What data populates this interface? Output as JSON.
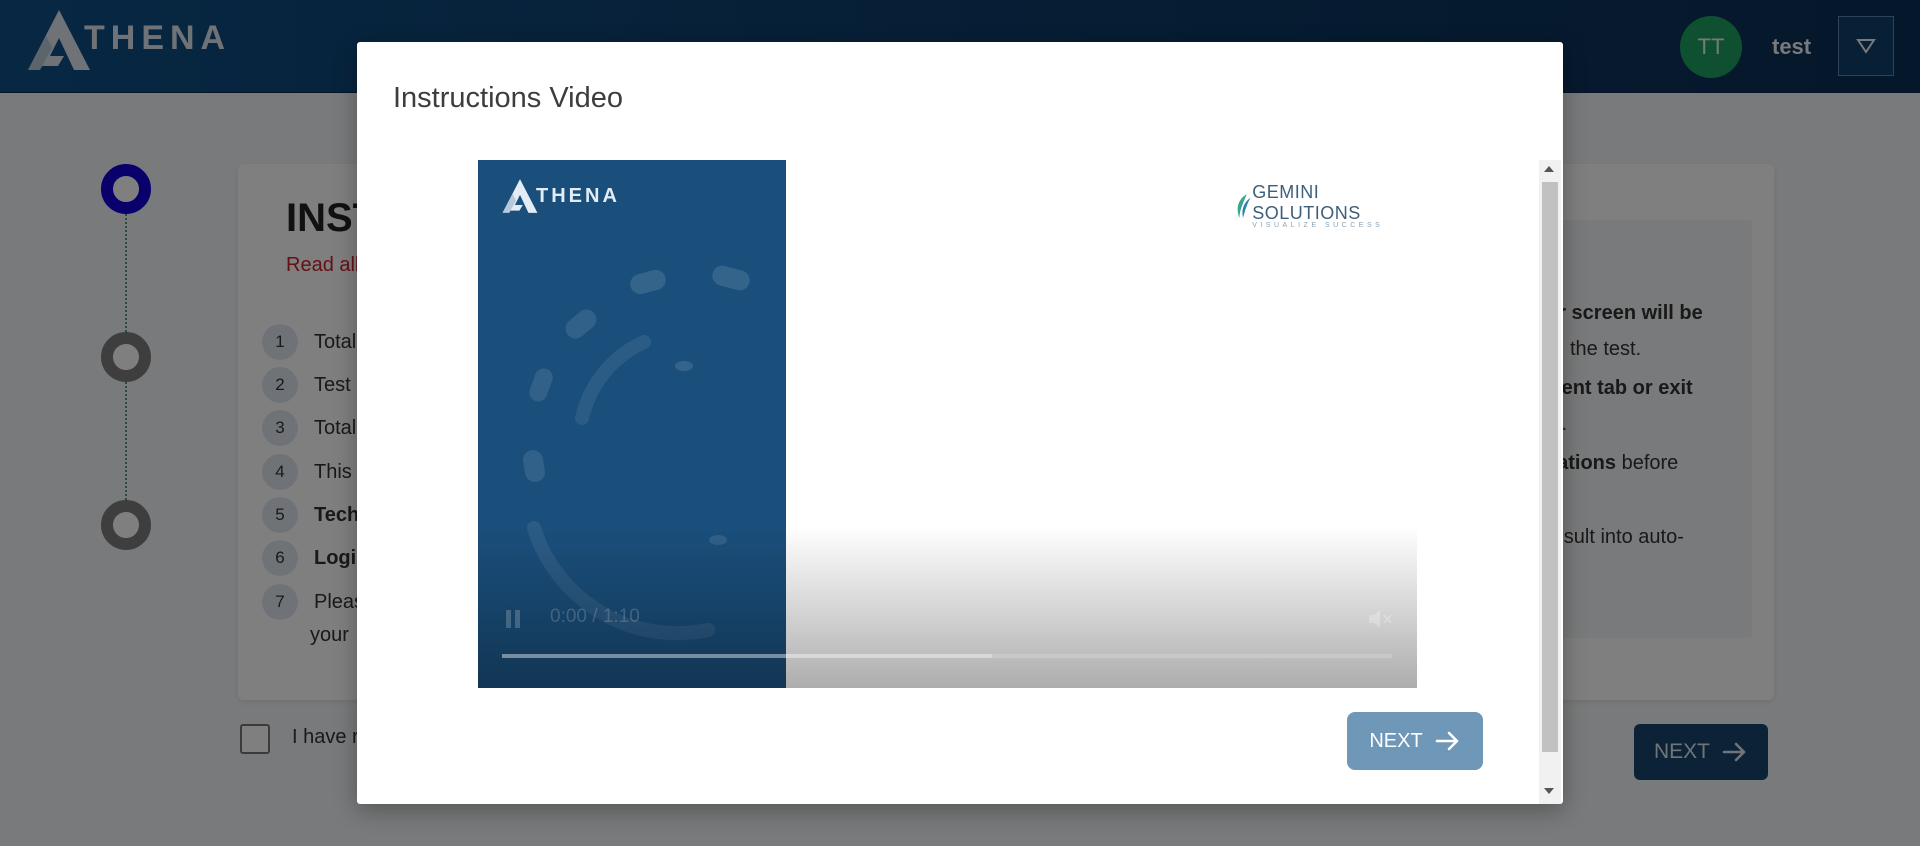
{
  "header": {
    "logo_text": "THENA",
    "avatar_initials": "TT",
    "username": "test",
    "dropdown_icon": "triangle-down-icon"
  },
  "background_page": {
    "title": "INST",
    "subtitle": "Read all",
    "instructions": [
      {
        "num": "1",
        "text": "Total"
      },
      {
        "num": "2",
        "text": "Test"
      },
      {
        "num": "3",
        "text": "Total"
      },
      {
        "num": "4",
        "text": "This"
      },
      {
        "num": "5",
        "text": "Techn"
      },
      {
        "num": "6",
        "text": "Logic"
      },
      {
        "num": "7",
        "text": "Pleas"
      }
    ],
    "instruction_7_continued": "your",
    "right_panel": {
      "line1": "ur screen will be",
      "line2": "the test.",
      "line3": "rrent tab or exit",
      "line4": "ts.",
      "line5_bold": "cations",
      "line5_rest": " before",
      "line6": "result into auto-"
    },
    "agreement_text": "I have r",
    "next_label": "NEXT"
  },
  "modal": {
    "title": "Instructions Video",
    "video": {
      "brand_logo_text": "THENA",
      "partner_logo_name": "GEMINI SOLUTIONS",
      "partner_logo_tagline": "VISUALIZE SUCCESS",
      "time_display": "0:00 / 1:10",
      "progress_fraction": 0.55
    },
    "next_label": "NEXT"
  },
  "colors": {
    "header_bg": "#0f4f86",
    "active_step": "#1300d8",
    "inactive_step": "#7c7c7c",
    "avatar_bg": "#1fa060",
    "modal_next_bg": "#6f97b8",
    "instruction_subtitle": "#c8202a"
  }
}
